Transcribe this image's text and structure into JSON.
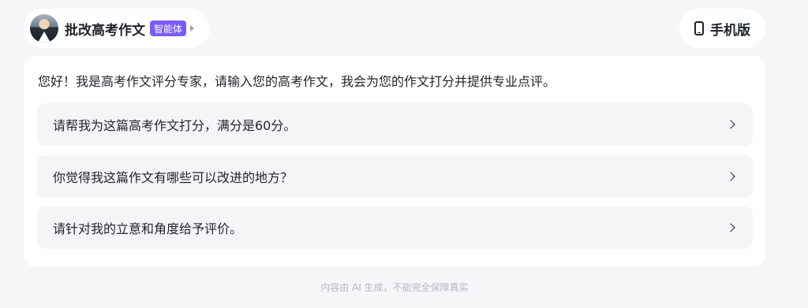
{
  "header": {
    "agent_name": "批改高考作文",
    "agent_badge": "智能体",
    "mobile_button_label": "手机版",
    "avatar_icon": "user-avatar",
    "caret_icon": "caret-right-icon",
    "phone_icon": "phone-icon"
  },
  "chat": {
    "greeting": "您好！我是高考作文评分专家，请输入您的高考作文，我会为您的作文打分并提供专业点评。",
    "suggestions": [
      {
        "text": "请帮我为这篇高考作文打分，满分是60分。"
      },
      {
        "text": "你觉得我这篇作文有哪些可以改进的地方？"
      },
      {
        "text": "请针对我的立意和角度给予评价。"
      }
    ]
  },
  "footer": {
    "disclaimer": "内容由 AI 生成，不能完全保障真实"
  },
  "colors": {
    "page_background": "#f5f6f8",
    "card_background": "#ffffff",
    "badge_accent": "#7a5af8",
    "suggestion_background": "#f4f5f7",
    "footer_text": "#b4b8be"
  }
}
